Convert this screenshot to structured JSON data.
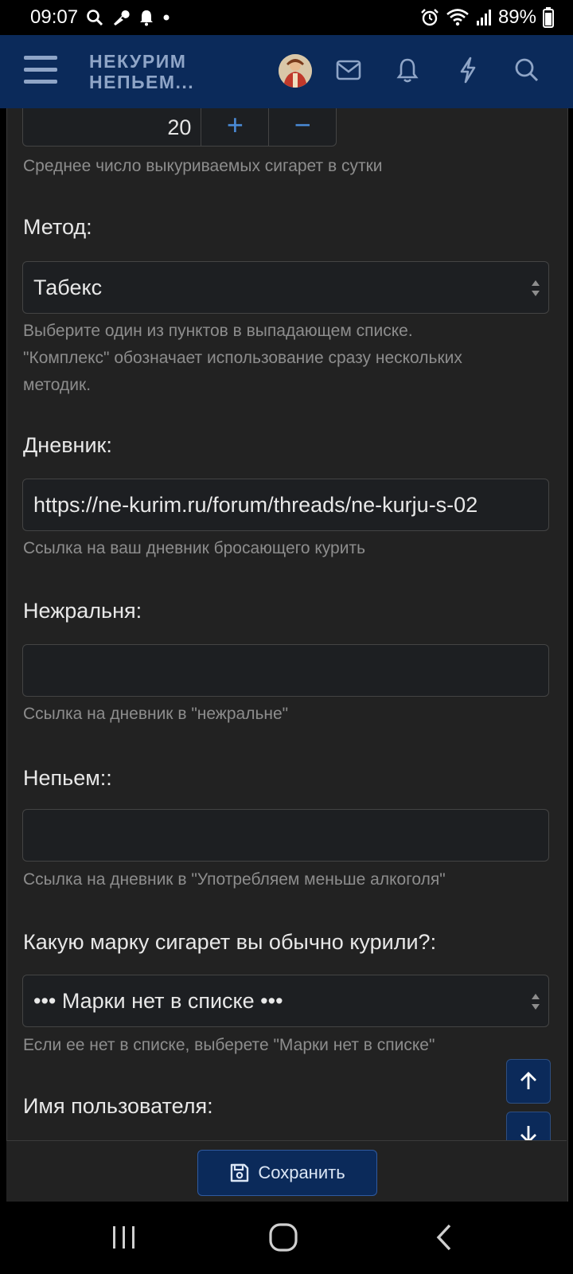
{
  "status_bar": {
    "time": "09:07",
    "battery": "89%"
  },
  "header": {
    "logo_line1": "НЕКУРИМ",
    "logo_line2": "НЕПЬЕМ..."
  },
  "form": {
    "cigs_per_day": {
      "value": "20",
      "plus": "+",
      "minus": "−",
      "hint": "Среднее число выкуриваемых сигарет в сутки"
    },
    "method": {
      "label": "Метод:",
      "value": "Табекс",
      "hint_line1": "Выберите один из пунктов в выпадающем списке.",
      "hint_line2": "\"Комплекс\" обозначает использование сразу нескольких",
      "hint_line3": "методик."
    },
    "diary": {
      "label": "Дневник:",
      "value": "https://ne-kurim.ru/forum/threads/ne-kurju-s-02",
      "hint": "Ссылка на ваш дневник бросающего курить"
    },
    "nezhralnya": {
      "label": "Нежральня:",
      "value": "",
      "hint": "Ссылка на дневник в \"нежральне\""
    },
    "nepem": {
      "label": "Непьем::",
      "value": "",
      "hint": "Ссылка на дневник в \"Употребляем меньше алкоголя\""
    },
    "brand": {
      "label": "Какую марку сигарет вы обычно курили?:",
      "value": "••• Марки нет в списке •••",
      "hint": "Если ее нет в списке, выберете \"Марки нет в списке\""
    },
    "username": {
      "label": "Имя пользователя:"
    }
  },
  "save_label": "Сохранить",
  "colors": {
    "header_bg": "#0b2a5a",
    "content_bg": "#222222",
    "accent": "#4a8ad6"
  }
}
